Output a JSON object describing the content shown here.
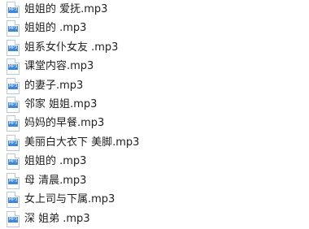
{
  "files": [
    {
      "icon": "audio-file-icon",
      "badge": "MP3",
      "name": "姐姐的     爱抚.mp3"
    },
    {
      "icon": "audio-file-icon",
      "badge": "MP3",
      "name": "姐姐的       .mp3"
    },
    {
      "icon": "audio-file-icon",
      "badge": "MP3",
      "name": "姐系女仆女友      .mp3"
    },
    {
      "icon": "audio-file-icon",
      "badge": "MP3",
      "name": "课堂内容.mp3"
    },
    {
      "icon": "audio-file-icon",
      "badge": "MP3",
      "name": "   的妻子.mp3"
    },
    {
      "icon": "audio-file-icon",
      "badge": "MP3",
      "name": "邻家 姐姐.mp3"
    },
    {
      "icon": "audio-file-icon",
      "badge": "MP3",
      "name": "妈妈的早餐.mp3"
    },
    {
      "icon": "audio-file-icon",
      "badge": "MP3",
      "name": "美丽白大衣下          美脚.mp3"
    },
    {
      "icon": "audio-file-icon",
      "badge": "MP3",
      "name": "   姐姐的          .mp3"
    },
    {
      "icon": "audio-file-icon",
      "badge": "MP3",
      "name": "母   清晨.mp3"
    },
    {
      "icon": "audio-file-icon",
      "badge": "MP3",
      "name": "女上司与下属.mp3"
    },
    {
      "icon": "audio-file-icon",
      "badge": "MP3",
      "name": "深   姐弟       .mp3"
    }
  ]
}
